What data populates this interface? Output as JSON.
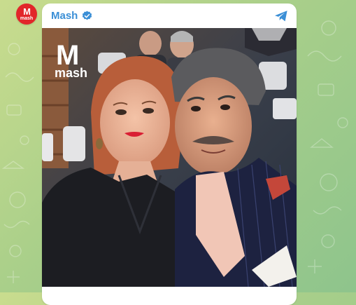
{
  "channel": {
    "name": "Mash",
    "verified": true,
    "accent_color": "#3b8fd6"
  },
  "avatar": {
    "brand_color": "#e2262a",
    "logo_letter": "M",
    "logo_word": "mash"
  },
  "photo": {
    "watermark_letter": "M",
    "watermark_word": "mash"
  },
  "icons": {
    "verified": "verified-badge-icon",
    "share": "telegram-share-icon"
  },
  "wallpaper": {
    "color_top": "#c9dc8e",
    "color_bottom": "#8ec48c"
  }
}
